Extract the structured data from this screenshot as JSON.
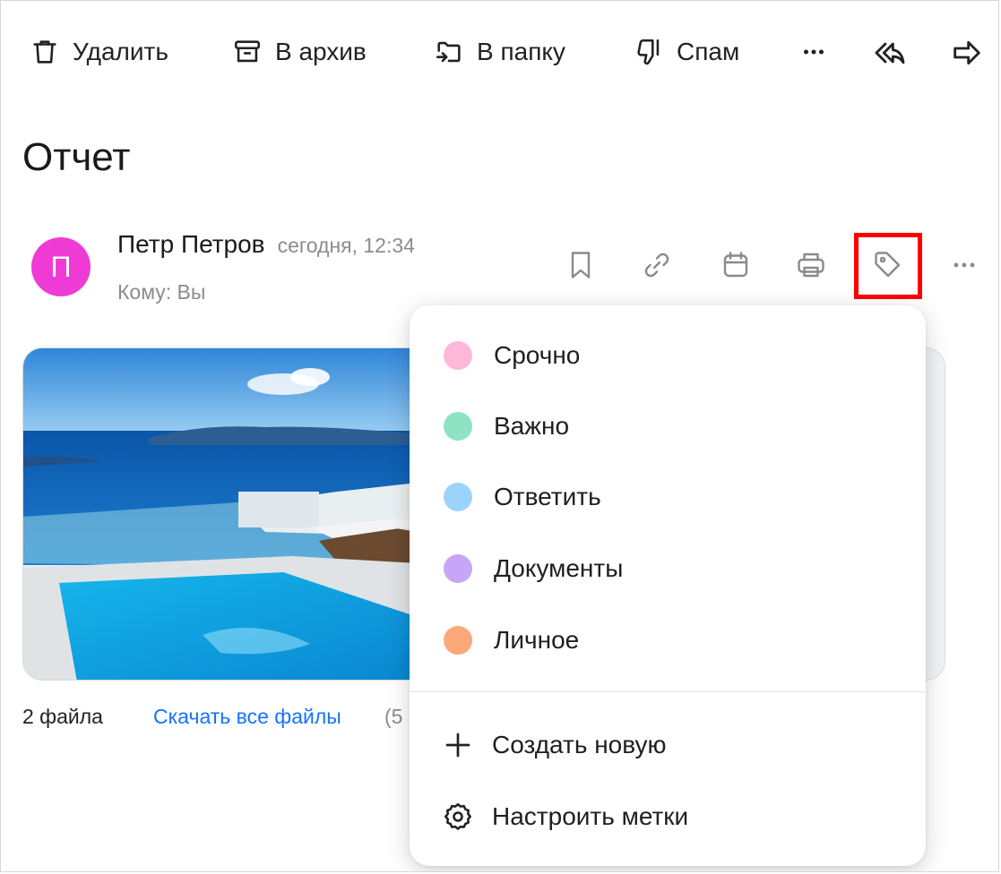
{
  "toolbar": {
    "delete_label": "Удалить",
    "archive_label": "В архив",
    "folder_label": "В папку",
    "spam_label": "Спам"
  },
  "message": {
    "subject": "Отчет",
    "avatar_letter": "П",
    "avatar_color": "#f03ad6",
    "sender_name": "Петр Петров",
    "date": "сегодня, 12:34",
    "recipient": "Кому: Вы"
  },
  "attachments": {
    "count_label": "2 файла",
    "download_all": "Скачать все файлы",
    "size_partial": "(5"
  },
  "labels_menu": {
    "items": [
      {
        "label": "Срочно",
        "color": "#fdb7d9"
      },
      {
        "label": "Важно",
        "color": "#8ee3c4"
      },
      {
        "label": "Ответить",
        "color": "#9cd3fc"
      },
      {
        "label": "Документы",
        "color": "#c7a6f8"
      },
      {
        "label": "Личное",
        "color": "#fca878"
      }
    ],
    "create_new": "Создать новую",
    "configure": "Настроить метки"
  },
  "icons": {
    "delete": "trash-icon",
    "archive": "archive-icon",
    "folder": "move-to-folder-icon",
    "spam": "thumbs-down-icon",
    "more": "more-horizontal-icon",
    "reply_all": "reply-all-icon",
    "forward": "forward-icon",
    "bookmark": "bookmark-icon",
    "link": "link-icon",
    "calendar": "calendar-icon",
    "print": "print-icon",
    "tag": "tag-icon",
    "plus": "plus-icon",
    "settings": "gear-icon"
  },
  "highlight_color": "#ff0000",
  "link_color": "#1673ff"
}
